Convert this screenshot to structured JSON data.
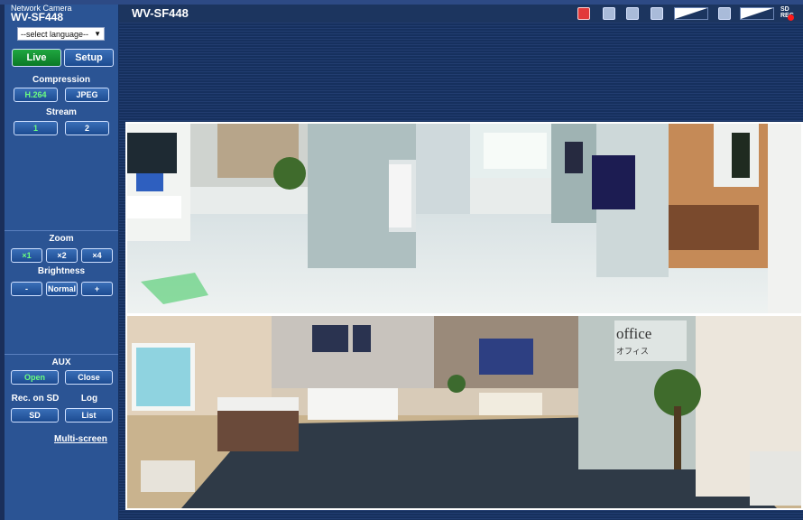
{
  "brand": {
    "sub": "Network Camera",
    "model": "WV-SF448"
  },
  "header": {
    "title": "WV-SF448",
    "sd_rec": "SD REC"
  },
  "language": {
    "selected": "--select language--"
  },
  "mode": {
    "live": "Live",
    "setup": "Setup"
  },
  "compression": {
    "title": "Compression",
    "h264": "H.264",
    "jpeg": "JPEG"
  },
  "stream": {
    "title": "Stream",
    "s1": "1",
    "s2": "2"
  },
  "zoom": {
    "title": "Zoom",
    "x1": "×1",
    "x2": "×2",
    "x4": "×4"
  },
  "brightness": {
    "title": "Brightness",
    "minus": "-",
    "normal": "Normal",
    "plus": "+"
  },
  "aux": {
    "title": "AUX",
    "open": "Open",
    "close": "Close"
  },
  "rec_sd": {
    "title": "Rec. on SD",
    "button": "SD"
  },
  "log": {
    "title": "Log",
    "button": "List"
  },
  "multiscreen": "Multi-screen",
  "scene": {
    "office_sign": "office",
    "office_kana": "オフィス"
  },
  "colors": {
    "live_green": "#1fa640",
    "active_text": "#6bff80",
    "rec_red": "#ff1a1a",
    "panel_blue": "#2b5494"
  },
  "icons": [
    "sd-record-icon",
    "snapshot-fullscreen-icon",
    "camera-snapshot-icon",
    "speaker-icon",
    "mic-mute-icon"
  ]
}
